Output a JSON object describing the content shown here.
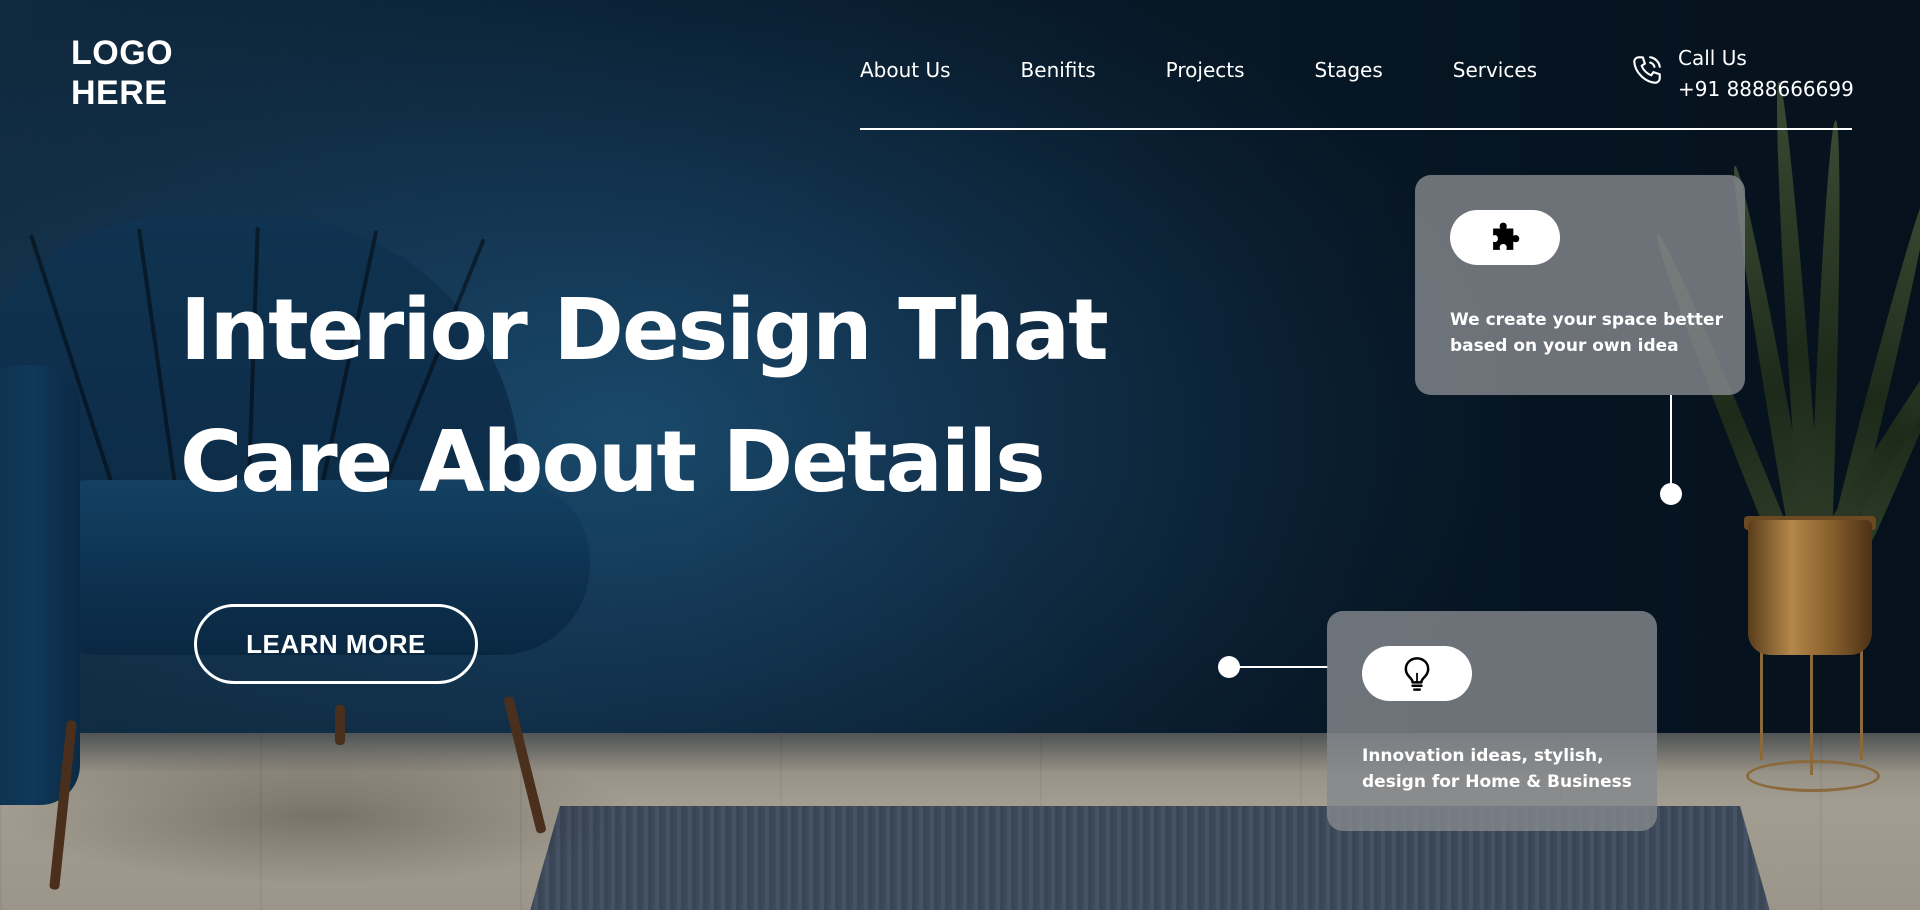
{
  "logo": {
    "line1": "LOGO",
    "line2": "HERE"
  },
  "nav": {
    "items": [
      {
        "label": "About Us"
      },
      {
        "label": "Benifits"
      },
      {
        "label": "Projects"
      },
      {
        "label": "Stages"
      },
      {
        "label": "Services"
      }
    ]
  },
  "contact": {
    "label": "Call Us",
    "phone": "+91 8888666699",
    "icon": "phone-icon"
  },
  "hero": {
    "title_line1": "Interior Design That",
    "title_line2": "Care About Details",
    "cta_label": "LEARN MORE"
  },
  "features": [
    {
      "icon": "puzzle-icon",
      "text": "We create your space better based on your own idea"
    },
    {
      "icon": "lightbulb-icon",
      "text": "Innovation ideas, stylish, design for Home & Business"
    }
  ],
  "colors": {
    "wall": "#12334f",
    "card": "#84888c",
    "text": "#ffffff",
    "floor": "#a39d91"
  }
}
